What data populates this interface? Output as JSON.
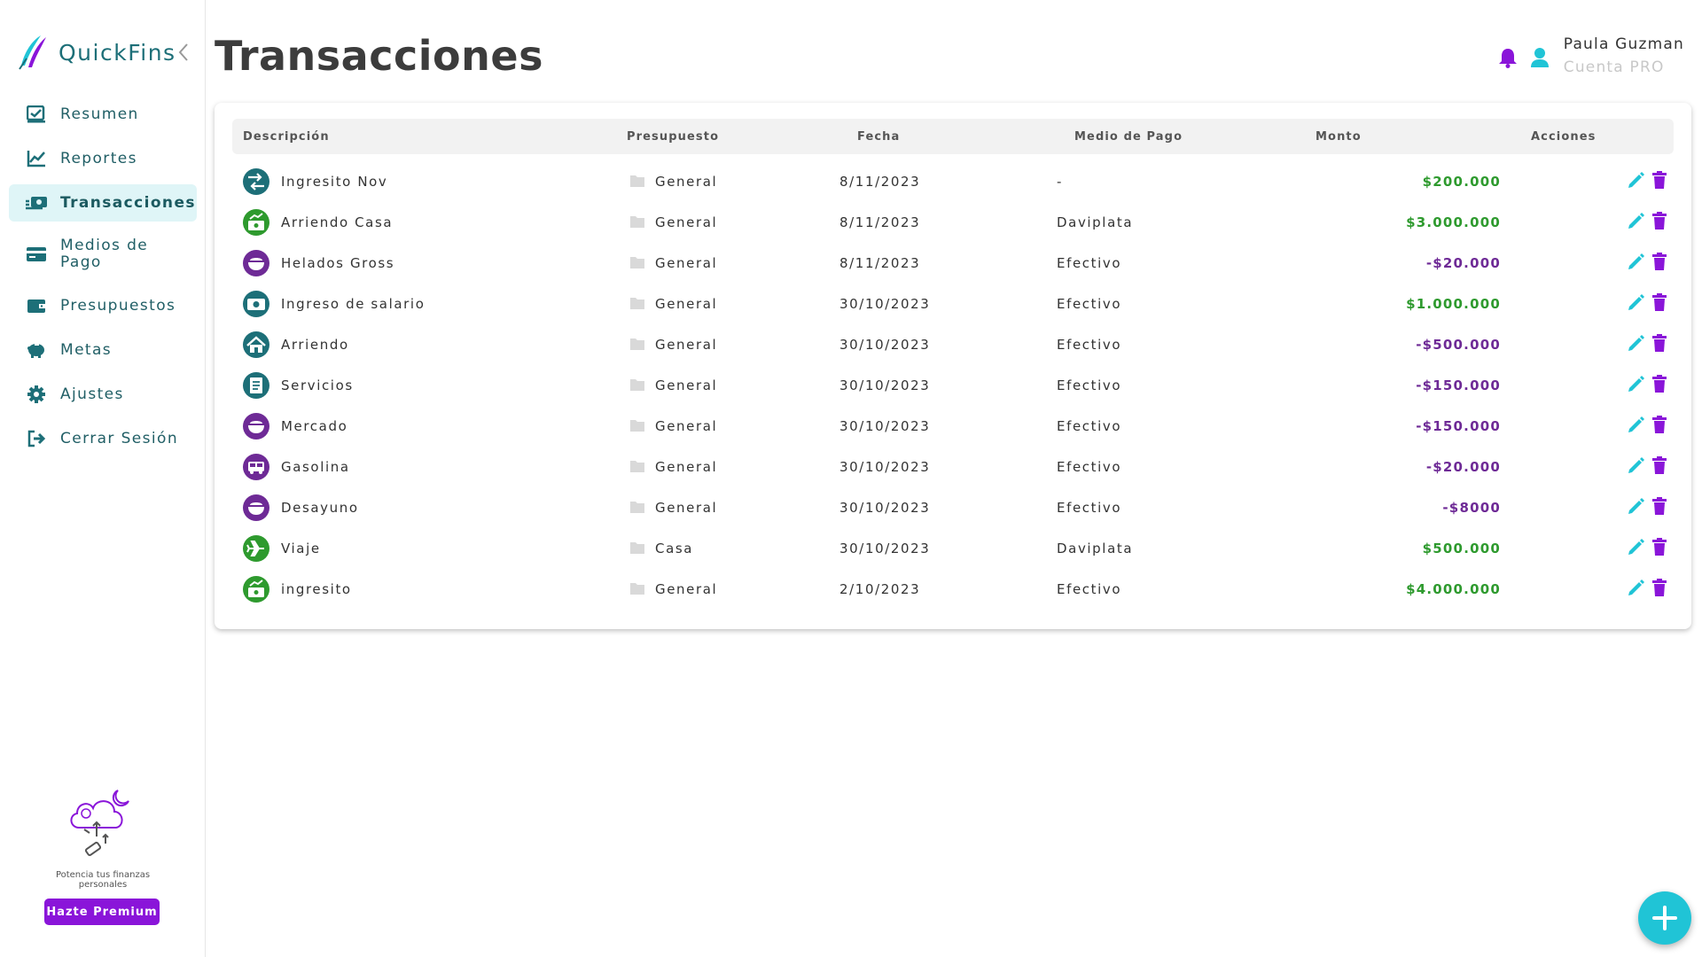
{
  "app": {
    "name": "QuickFins"
  },
  "sidebar": {
    "items": [
      {
        "label": "Resumen",
        "icon": "chart-check-icon"
      },
      {
        "label": "Reportes",
        "icon": "line-chart-icon"
      },
      {
        "label": "Transacciones",
        "icon": "money-transfer-icon",
        "active": true
      },
      {
        "label": "Medios de Pago",
        "icon": "credit-card-icon"
      },
      {
        "label": "Presupuestos",
        "icon": "wallet-icon"
      },
      {
        "label": "Metas",
        "icon": "piggy-bank-icon"
      },
      {
        "label": "Ajustes",
        "icon": "gear-icon"
      },
      {
        "label": "Cerrar Sesión",
        "icon": "logout-icon"
      }
    ],
    "promo_text": "Potencia tus finanzas personales",
    "premium_label": "Hazte Premium"
  },
  "header": {
    "title": "Transacciones",
    "user_name": "Paula Guzman",
    "user_plan": "Cuenta PRO"
  },
  "table": {
    "columns": [
      "Descripción",
      "Presupuesto",
      "Fecha",
      "Medio de Pago",
      "Monto",
      "Acciones"
    ],
    "rows": [
      {
        "description": "Ingresito Nov",
        "budget": "General",
        "date": "8/11/2023",
        "payment": "-",
        "amount": "$200.000",
        "kind": "pos",
        "icon": "transfer-icon",
        "icon_color": "#1d6f78"
      },
      {
        "description": "Arriendo Casa",
        "budget": "General",
        "date": "8/11/2023",
        "payment": "Daviplata",
        "amount": "$3.000.000",
        "kind": "pos",
        "icon": "money-growth-icon",
        "icon_color": "#2e9a2e"
      },
      {
        "description": "Helados Gross",
        "budget": "General",
        "date": "8/11/2023",
        "payment": "Efectivo",
        "amount": "-$20.000",
        "kind": "neg",
        "icon": "food-bowl-icon",
        "icon_color": "#6e2a96"
      },
      {
        "description": "Ingreso de salario",
        "budget": "General",
        "date": "30/10/2023",
        "payment": "Efectivo",
        "amount": "$1.000.000",
        "kind": "pos",
        "icon": "cash-icon",
        "icon_color": "#1d6f78"
      },
      {
        "description": "Arriendo",
        "budget": "General",
        "date": "30/10/2023",
        "payment": "Efectivo",
        "amount": "-$500.000",
        "kind": "neg",
        "icon": "house-icon",
        "icon_color": "#1d6f78"
      },
      {
        "description": "Servicios",
        "budget": "General",
        "date": "30/10/2023",
        "payment": "Efectivo",
        "amount": "-$150.000",
        "kind": "neg",
        "icon": "receipt-icon",
        "icon_color": "#1d6f78"
      },
      {
        "description": "Mercado",
        "budget": "General",
        "date": "30/10/2023",
        "payment": "Efectivo",
        "amount": "-$150.000",
        "kind": "neg",
        "icon": "food-bowl-icon",
        "icon_color": "#6e2a96"
      },
      {
        "description": "Gasolina",
        "budget": "General",
        "date": "30/10/2023",
        "payment": "Efectivo",
        "amount": "-$20.000",
        "kind": "neg",
        "icon": "bus-icon",
        "icon_color": "#6e2a96"
      },
      {
        "description": "Desayuno",
        "budget": "General",
        "date": "30/10/2023",
        "payment": "Efectivo",
        "amount": "-$8000",
        "kind": "neg",
        "icon": "food-bowl-icon",
        "icon_color": "#6e2a96"
      },
      {
        "description": "Viaje",
        "budget": "Casa",
        "date": "30/10/2023",
        "payment": "Daviplata",
        "amount": "$500.000",
        "kind": "pos",
        "icon": "airplane-icon",
        "icon_color": "#2e9a2e"
      },
      {
        "description": "ingresito",
        "budget": "General",
        "date": "2/10/2023",
        "payment": "Efectivo",
        "amount": "$4.000.000",
        "kind": "pos",
        "icon": "money-growth-icon",
        "icon_color": "#2e9a2e"
      }
    ]
  },
  "colors": {
    "brand": "#1d6f78",
    "accent_cyan": "#20c4d6",
    "accent_purple": "#8a15d9",
    "positive": "#2e9a2e",
    "negative": "#6e2a96"
  }
}
